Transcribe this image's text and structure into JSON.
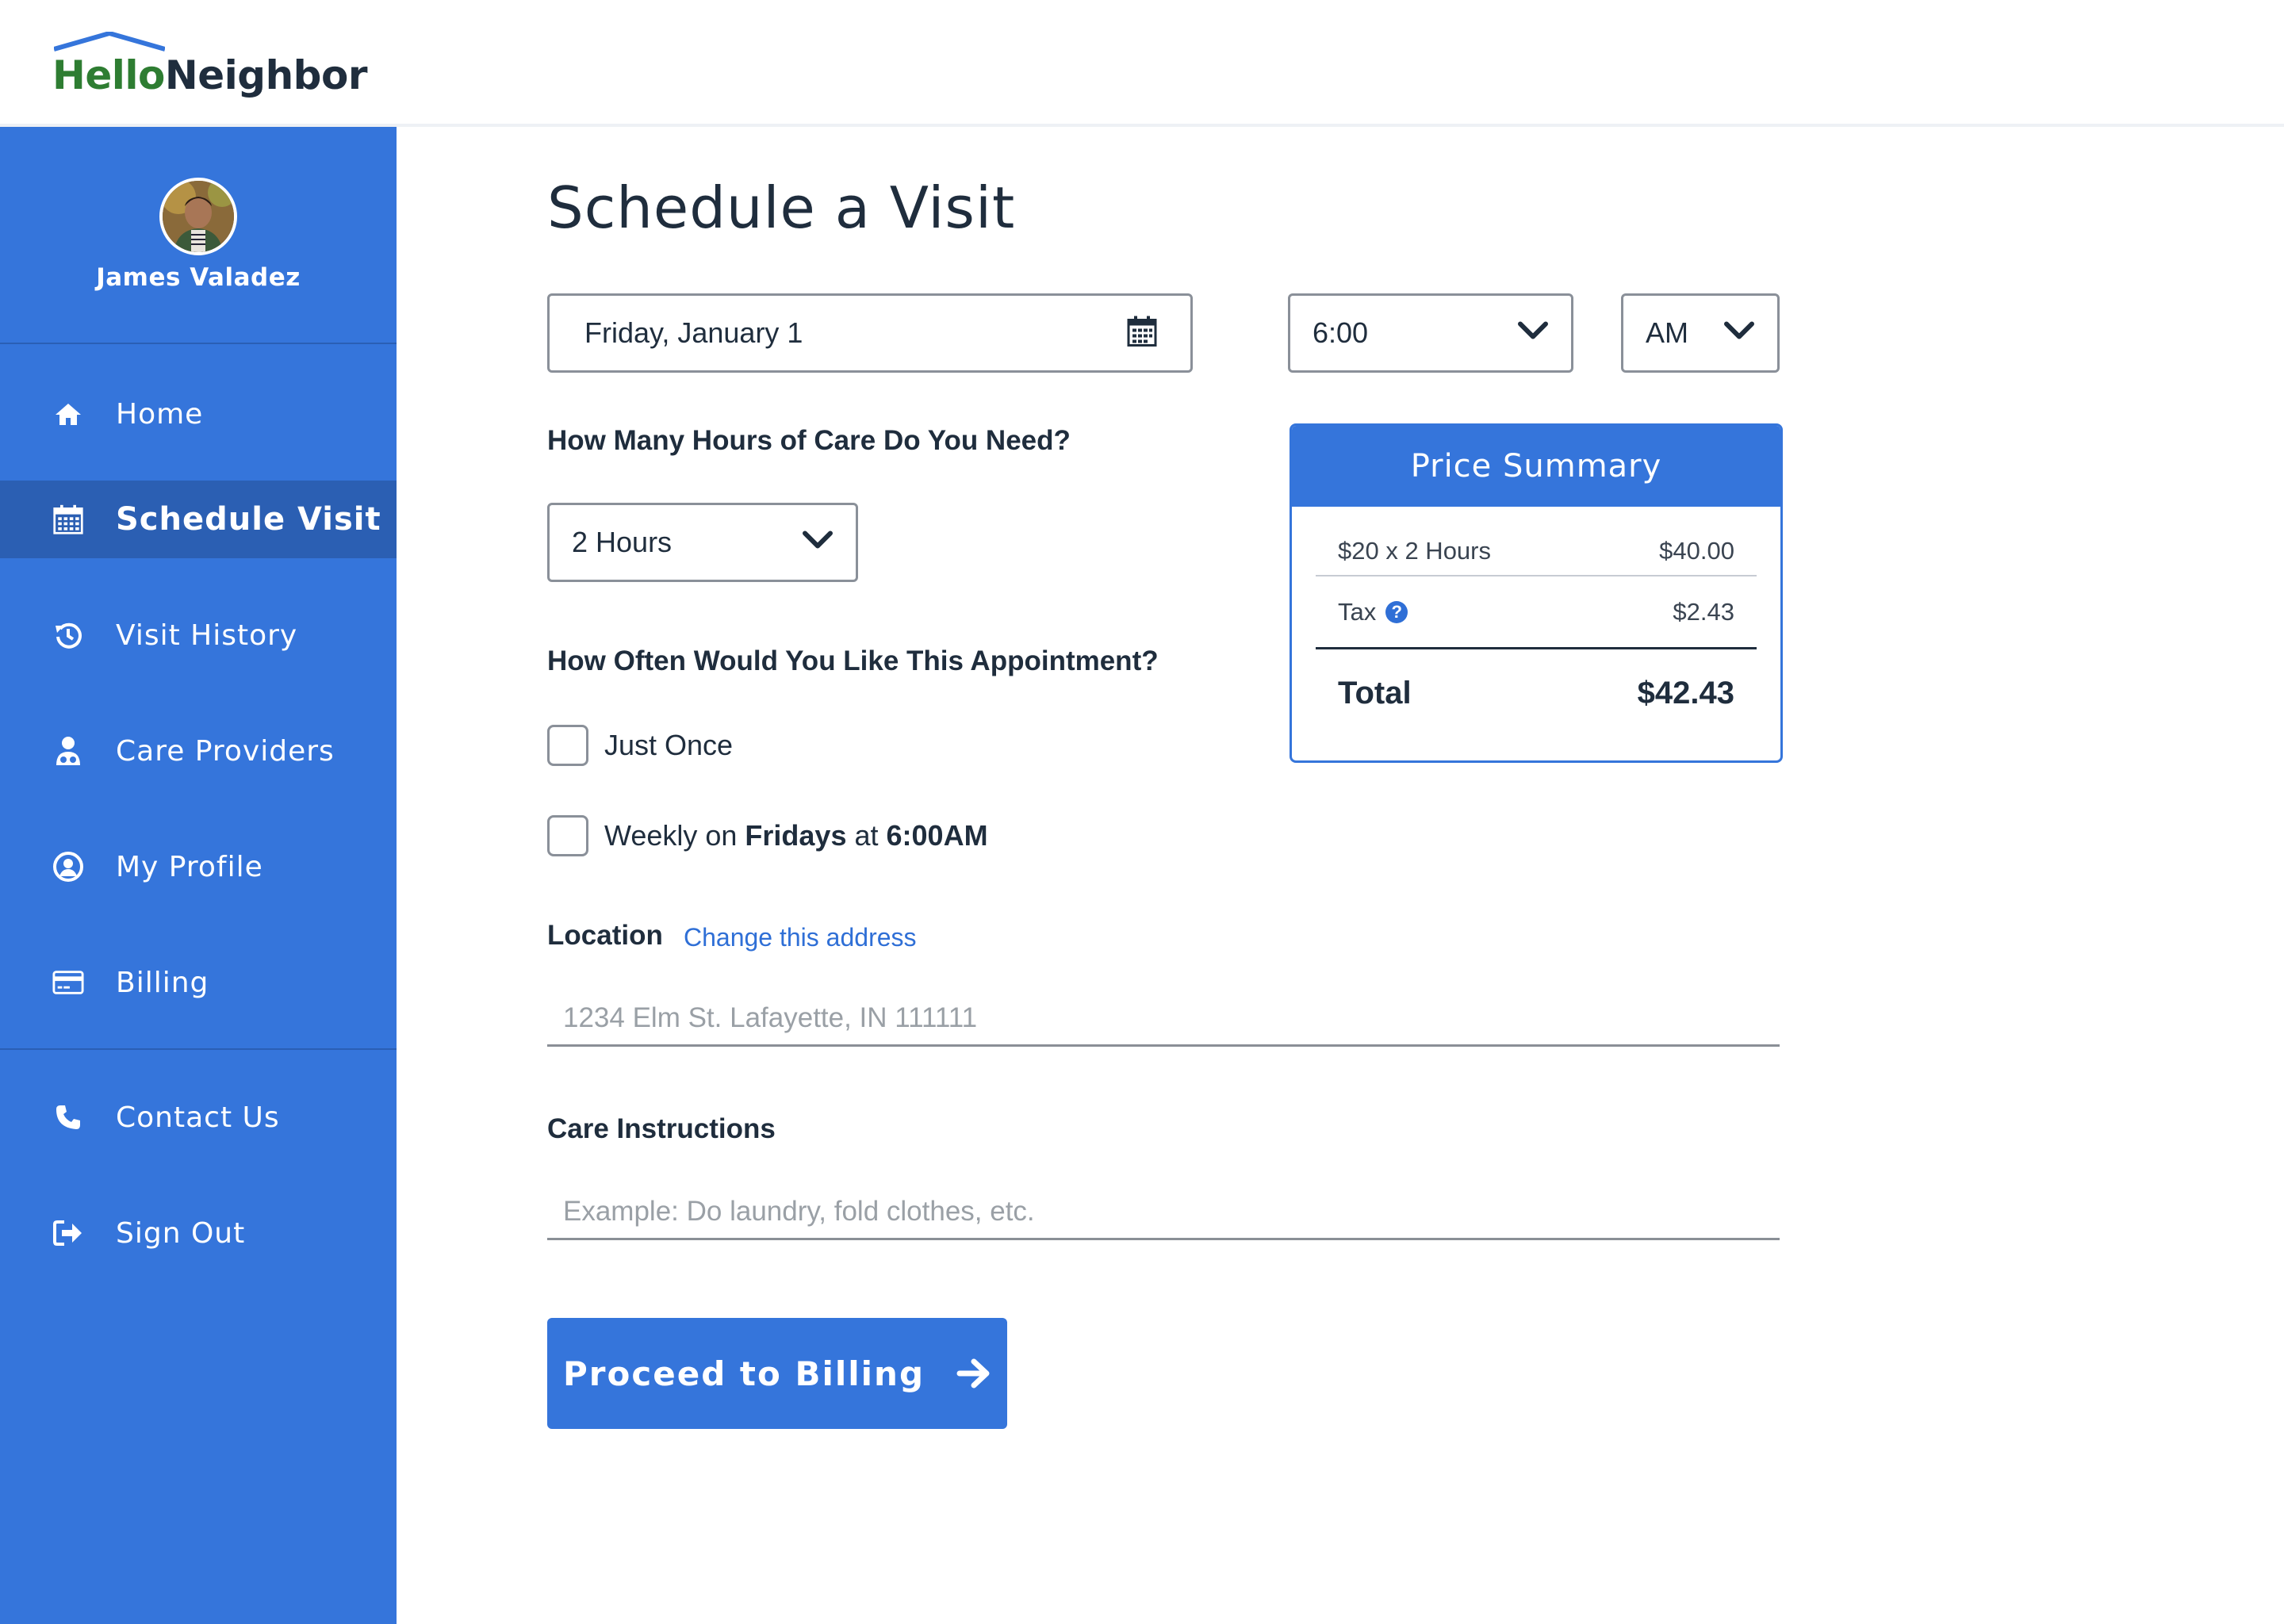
{
  "brand": {
    "hello": "Hello",
    "neighbor": "Neighbor"
  },
  "user": {
    "name": "James Valadez"
  },
  "sidebar": {
    "items": [
      {
        "label": "Home",
        "icon": "home-icon"
      },
      {
        "label": "Schedule Visit",
        "icon": "calendar-icon",
        "active": true
      },
      {
        "label": "Visit History",
        "icon": "history-icon"
      },
      {
        "label": "Care Providers",
        "icon": "care-provider-icon"
      },
      {
        "label": "My Profile",
        "icon": "user-circle-icon"
      },
      {
        "label": "Billing",
        "icon": "credit-card-icon"
      },
      {
        "label": "Contact Us",
        "icon": "phone-icon"
      },
      {
        "label": "Sign Out",
        "icon": "sign-out-icon"
      }
    ]
  },
  "main": {
    "title": "Schedule a Visit",
    "date": {
      "value": "Friday, January 1"
    },
    "time": {
      "value": "6:00"
    },
    "ampm": {
      "value": "AM"
    },
    "hours_question": "How Many Hours of Care Do You Need?",
    "hours": {
      "value": "2 Hours"
    },
    "frequency_question": "How Often Would You Like This Appointment?",
    "frequency": {
      "once": "Just Once",
      "weekly_prefix": "Weekly on ",
      "weekly_day": "Fridays",
      "weekly_mid": " at ",
      "weekly_time": "6:00AM"
    },
    "location": {
      "label": "Location",
      "change_link": "Change this address",
      "placeholder": "1234 Elm St. Lafayette, IN 111111"
    },
    "care_instructions": {
      "label": "Care Instructions",
      "placeholder": "Example: Do laundry, fold clothes, etc."
    },
    "proceed_label": "Proceed to Billing"
  },
  "price_summary": {
    "title": "Price Summary",
    "line_label": "$20 x 2 Hours",
    "line_value": "$40.00",
    "tax_label": "Tax",
    "tax_value": "$2.43",
    "total_label": "Total",
    "total_value": "$42.43"
  },
  "colors": {
    "primary": "#3575db",
    "active_nav": "#2b5fb3",
    "logo_green": "#2e7d32",
    "text": "#1f2d3d",
    "link": "#2f6fd6"
  }
}
